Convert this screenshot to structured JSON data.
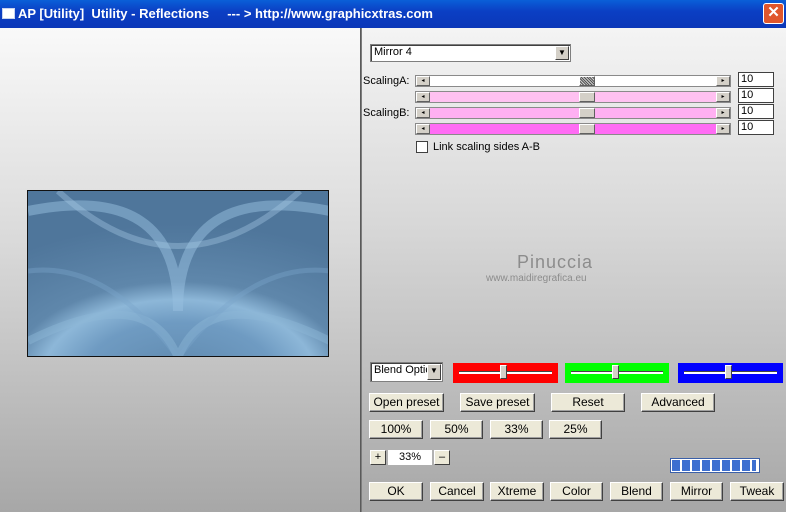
{
  "window": {
    "title": "AP [Utility]  Utility - Reflections     --- > http://www.graphicxtras.com",
    "close_glyph": "✕"
  },
  "preset_combo": {
    "value": "Mirror 4"
  },
  "scaling": {
    "label_a": "ScalingA:",
    "label_b": "ScalingB:",
    "values": [
      "10",
      "10",
      "10",
      "10"
    ],
    "colors": [
      "#ffffff",
      "#ffc1f1",
      "#ffb0f2",
      "#ff6cf4"
    ]
  },
  "link_checkbox": {
    "label": "Link scaling sides A-B",
    "checked": false
  },
  "watermark": {
    "title": "Pinuccia",
    "subtitle": "www.maidiregrafica.eu"
  },
  "blend": {
    "combo_value": "Blend Optio",
    "rgb": [
      {
        "color": "#ff0000",
        "level": 0.48
      },
      {
        "color": "#00ff00",
        "level": 0.48
      },
      {
        "color": "#0000ff",
        "level": 0.48
      }
    ]
  },
  "buttons_row1": {
    "open_preset": "Open preset",
    "save_preset": "Save preset",
    "reset": "Reset",
    "advanced": "Advanced"
  },
  "zoom_buttons": {
    "z100": "100%",
    "z50": "50%",
    "z33": "33%",
    "z25": "25%"
  },
  "zoom": {
    "plus": "+",
    "minus": "–",
    "value": "33%"
  },
  "progress": {
    "fraction": 0.98
  },
  "bottom_buttons": {
    "ok": "OK",
    "cancel": "Cancel",
    "xtreme": "Xtreme",
    "color": "Color",
    "blend": "Blend",
    "mirror": "Mirror",
    "tweak": "Tweak"
  },
  "scroll_arrows": {
    "left": "◂",
    "right": "▸"
  },
  "icons": [
    "window-icon",
    "close-icon",
    "dropdown-arrow-icon",
    "scroll-left-icon",
    "scroll-right-icon"
  ]
}
